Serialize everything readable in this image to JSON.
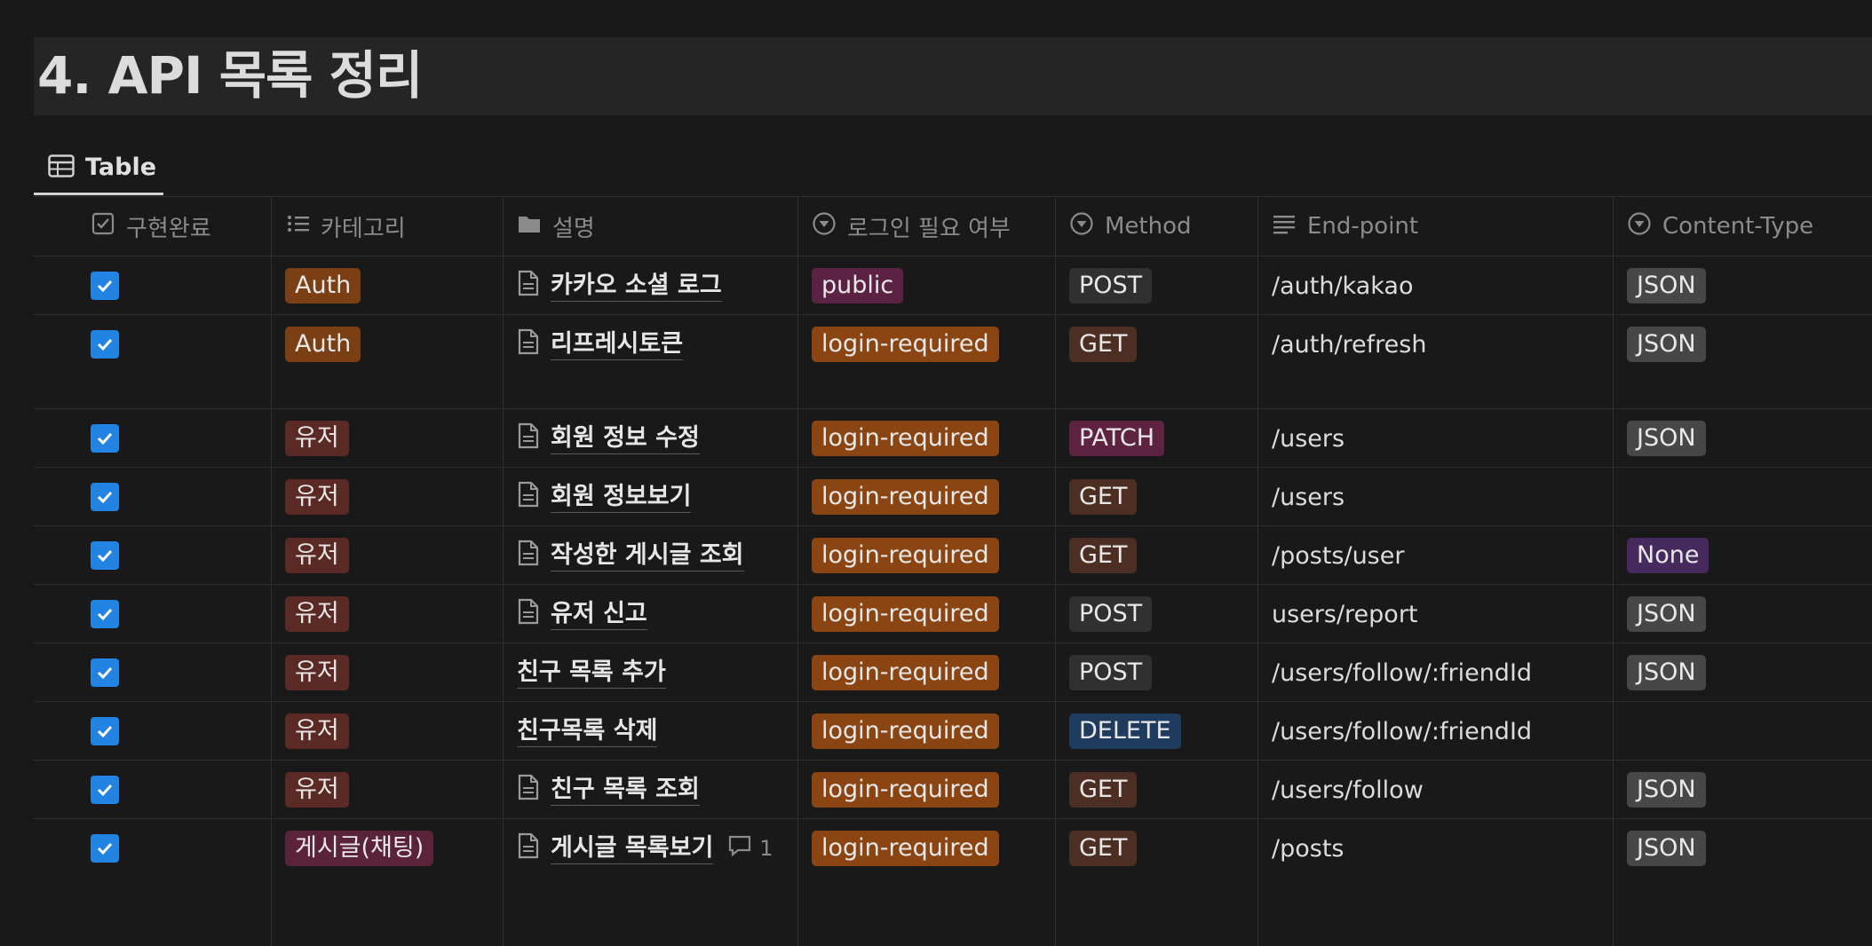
{
  "page": {
    "title": "4. API 목록 정리"
  },
  "view": {
    "tab_label": "Table"
  },
  "columns": [
    {
      "label": "구현완료",
      "icon": "checkbox-icon"
    },
    {
      "label": "카테고리",
      "icon": "list-icon"
    },
    {
      "label": "설명",
      "icon": "folder-icon"
    },
    {
      "label": "로그인 필요 여부",
      "icon": "select-icon"
    },
    {
      "label": "Method",
      "icon": "select-icon"
    },
    {
      "label": "End-point",
      "icon": "text-icon"
    },
    {
      "label": "Content-Type",
      "icon": "select-icon"
    }
  ],
  "rows": [
    {
      "done": true,
      "category": "Auth",
      "category_color": "auth",
      "desc": "카카오 소셜 로그",
      "desc_is_page": true,
      "login": "public",
      "method": "POST",
      "endpoint": "/auth/kakao",
      "content_type": "JSON"
    },
    {
      "done": true,
      "category": "Auth",
      "category_color": "auth",
      "desc": "리프레시토큰",
      "desc_is_page": true,
      "login": "login-required",
      "method": "GET",
      "endpoint": "/auth/refresh",
      "content_type": "JSON"
    },
    {
      "done": true,
      "category": "유저",
      "category_color": "user",
      "desc": "회원 정보 수정",
      "desc_is_page": true,
      "login": "login-required",
      "method": "PATCH",
      "endpoint": "/users",
      "content_type": "JSON"
    },
    {
      "done": true,
      "category": "유저",
      "category_color": "user",
      "desc": "회원 정보보기",
      "desc_is_page": true,
      "login": "login-required",
      "method": "GET",
      "endpoint": "/users",
      "content_type": ""
    },
    {
      "done": true,
      "category": "유저",
      "category_color": "user",
      "desc": "작성한 게시글 조회",
      "desc_is_page": true,
      "login": "login-required",
      "method": "GET",
      "endpoint": "/posts/user",
      "content_type": "None"
    },
    {
      "done": true,
      "category": "유저",
      "category_color": "user",
      "desc": "유저 신고",
      "desc_is_page": true,
      "login": "login-required",
      "method": "POST",
      "endpoint": "users/report",
      "content_type": "JSON"
    },
    {
      "done": true,
      "category": "유저",
      "category_color": "user",
      "desc": "친구 목록 추가",
      "desc_is_page": false,
      "login": "login-required",
      "method": "POST",
      "endpoint": "/users/follow/:friendId",
      "content_type": "JSON"
    },
    {
      "done": true,
      "category": "유저",
      "category_color": "user",
      "desc": "친구목록 삭제",
      "desc_is_page": false,
      "login": "login-required",
      "method": "DELETE",
      "endpoint": "/users/follow/:friendId",
      "content_type": ""
    },
    {
      "done": true,
      "category": "유저",
      "category_color": "user",
      "desc": "친구 목록 조회",
      "desc_is_page": true,
      "login": "login-required",
      "method": "GET",
      "endpoint": "/users/follow",
      "content_type": "JSON"
    },
    {
      "done": true,
      "category": "게시글(채팅)",
      "category_color": "post",
      "desc": "게시글 목록보기",
      "desc_is_page": true,
      "comment_count": "1",
      "login": "login-required",
      "method": "GET",
      "endpoint": "/posts",
      "content_type": "JSON"
    }
  ],
  "colors": {
    "background": "#191919",
    "checkbox": "#2383e2"
  }
}
